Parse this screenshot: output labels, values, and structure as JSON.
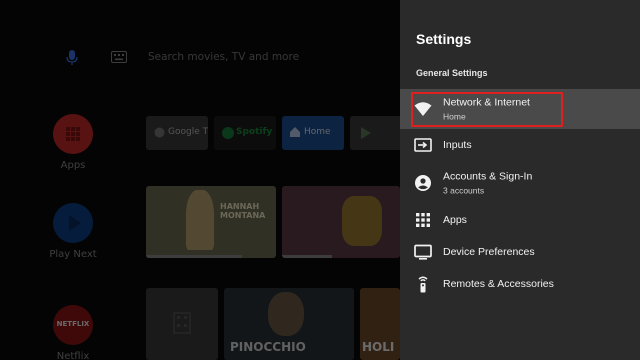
{
  "home": {
    "search_hint": "Search movies, TV and more",
    "nav": [
      {
        "label": "Apps"
      },
      {
        "label": "Play Next"
      },
      {
        "label": "Netflix",
        "badge": "NETFLIX"
      }
    ],
    "apps": [
      {
        "label": "Google TV"
      },
      {
        "label": "Spotify"
      },
      {
        "label": "Home"
      },
      {
        "label": ""
      }
    ],
    "cards": {
      "hannah": "HANNAH MONTANA",
      "pinocchio": "PINOCCHIO",
      "holi": "HOLI"
    },
    "colors": {
      "apps_circle": "#c62828",
      "playnext_circle": "#1565c0",
      "netflix_circle": "#b71c1c",
      "spotify": "#1db954",
      "home_tile": "#1e63b8"
    }
  },
  "settings": {
    "title": "Settings",
    "section": "General Settings",
    "items": [
      {
        "label": "Network & Internet",
        "sub": "Home",
        "icon": "wifi-icon",
        "selected": true
      },
      {
        "label": "Inputs",
        "sub": "",
        "icon": "input-icon"
      },
      {
        "label": "Accounts & Sign-In",
        "sub": "3 accounts",
        "icon": "account-icon"
      },
      {
        "label": "Apps",
        "sub": "",
        "icon": "apps-grid-icon"
      },
      {
        "label": "Device Preferences",
        "sub": "",
        "icon": "tv-icon"
      },
      {
        "label": "Remotes & Accessories",
        "sub": "",
        "icon": "remote-icon"
      }
    ],
    "focus_color": "#e02020"
  }
}
